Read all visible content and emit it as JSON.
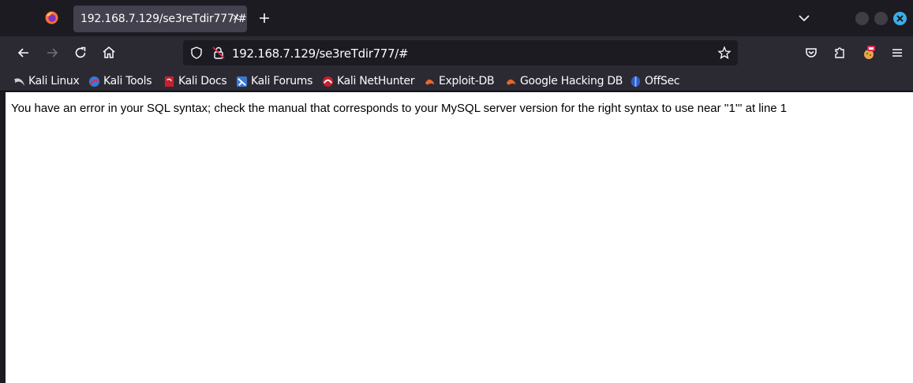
{
  "tab": {
    "title": "192.168.7.129/se3reTdir777/#",
    "close": "×"
  },
  "urlbar": {
    "host": "192.168.7.129",
    "path": "/se3reTdir777/#"
  },
  "bookmarks": [
    {
      "label": "Kali Linux",
      "icon": "kali-dragon-icon"
    },
    {
      "label": "Kali Tools",
      "icon": "kali-tools-icon"
    },
    {
      "label": "Kali Docs",
      "icon": "kali-docs-icon"
    },
    {
      "label": "Kali Forums",
      "icon": "kali-forums-icon"
    },
    {
      "label": "Kali NetHunter",
      "icon": "nethunter-icon"
    },
    {
      "label": "Exploit-DB",
      "icon": "exploit-db-icon"
    },
    {
      "label": "Google Hacking DB",
      "icon": "ghdb-icon"
    },
    {
      "label": "OffSec",
      "icon": "offsec-icon"
    }
  ],
  "page": {
    "error_message": "You have an error in your SQL syntax; check the manual that corresponds to your MySQL server version for the right syntax to use near ''1''' at line 1"
  },
  "colors": {
    "chrome_dark": "#1c1b22",
    "toolbar": "#2b2a33",
    "tab_active": "#42414d",
    "close_button": "#3daee9"
  }
}
